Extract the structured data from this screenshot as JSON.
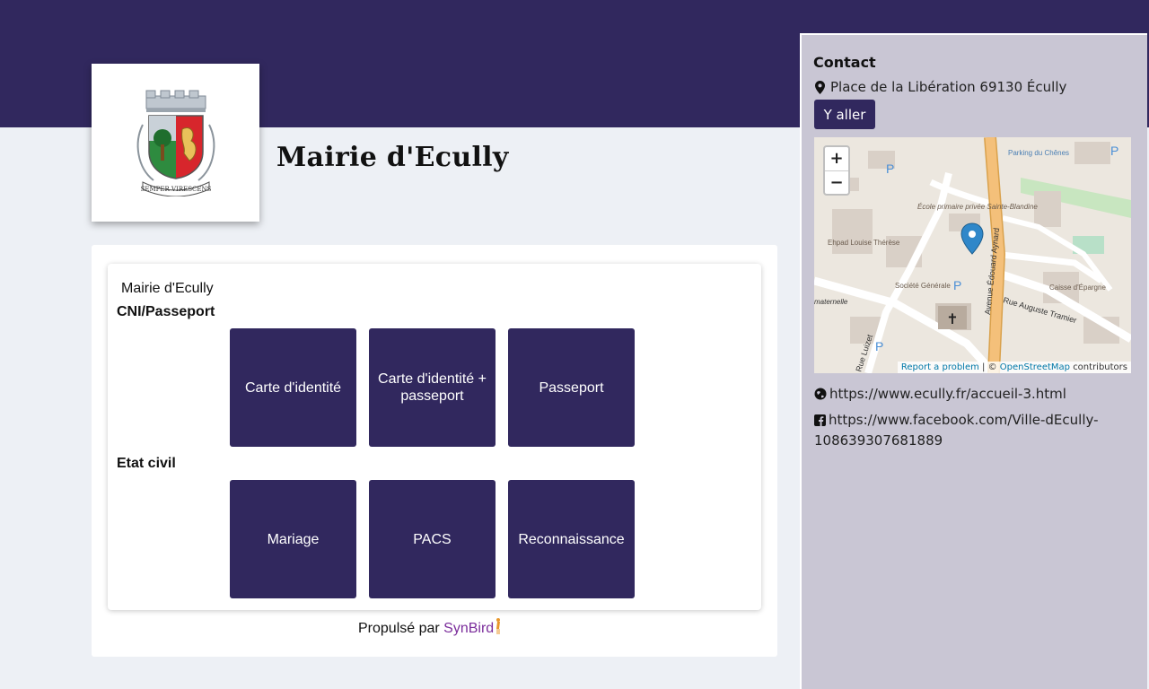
{
  "org": {
    "name": "Mairie d'Ecully"
  },
  "logo": {
    "motto": "SEMPER VIRESCENS"
  },
  "widget": {
    "title": "Mairie d'Ecully",
    "sections": [
      {
        "title": "CNI/Passeport",
        "tiles": [
          "Carte d'identité",
          "Carte d'identité + passeport",
          "Passeport"
        ]
      },
      {
        "title": "Etat civil",
        "tiles": [
          "Mariage",
          "PACS",
          "Reconnaissance"
        ]
      }
    ]
  },
  "footer": {
    "powered_prefix": "Propulsé par",
    "brand": "SynBird"
  },
  "contact": {
    "title": "Contact",
    "address": "Place de la Libération 69130 Écully",
    "go_button": "Y aller",
    "website": "https://www.ecully.fr/accueil-3.html",
    "facebook": "https://www.facebook.com/Ville-dEcully-108639307681889"
  },
  "map": {
    "zoom_in": "+",
    "zoom_out": "−",
    "attribution_report": "Report a problem",
    "attribution_sep": "| ©",
    "attribution_osm": "OpenStreetMap",
    "attribution_suffix": "contributors",
    "labels": {
      "parking": "Parking du Chênes",
      "school": "École primaire privée Sainte-Blandine",
      "ehpad": "Ehpad Louise Thérèse",
      "societe": "Société Générale",
      "caisse": "Caisse d'Épargne",
      "avenue": "Avenue Édouard Aynard",
      "rue_tramier": "Rue Auguste Tramier",
      "rue_luizet": "Rue Luizet",
      "maternelle": "maternelle"
    }
  },
  "colors": {
    "brand": "#31285e",
    "sidebar": "#c9c6d4",
    "accent": "#7b2d9b"
  }
}
